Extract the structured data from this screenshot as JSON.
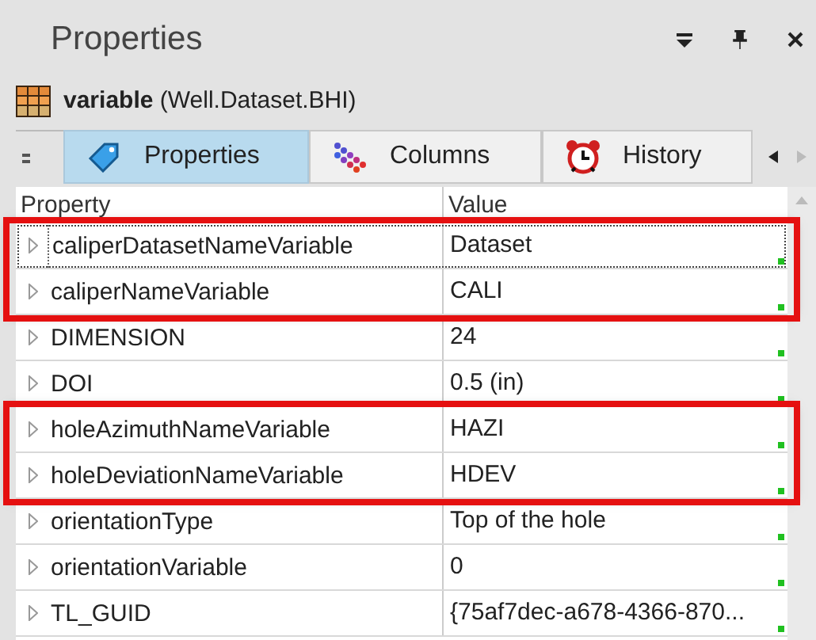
{
  "panel": {
    "title": "Properties"
  },
  "object": {
    "name": "variable",
    "path": "(Well.Dataset.BHI)"
  },
  "tabs": [
    {
      "label": "Properties",
      "selected": true
    },
    {
      "label": "Columns",
      "selected": false
    },
    {
      "label": "History",
      "selected": false
    }
  ],
  "table": {
    "columns": [
      "Property",
      "Value"
    ],
    "rows": [
      {
        "name": "caliperDatasetNameVariable",
        "value": "Dataset",
        "focused": true,
        "highlighted": true
      },
      {
        "name": "caliperNameVariable",
        "value": "CALI",
        "focused": false,
        "highlighted": true
      },
      {
        "name": "DIMENSION",
        "value": "24",
        "focused": false,
        "highlighted": false
      },
      {
        "name": "DOI",
        "value": "0.5 (in)",
        "focused": false,
        "highlighted": false
      },
      {
        "name": "holeAzimuthNameVariable",
        "value": "HAZI",
        "focused": false,
        "highlighted": true
      },
      {
        "name": "holeDeviationNameVariable",
        "value": "HDEV",
        "focused": false,
        "highlighted": true
      },
      {
        "name": "orientationType",
        "value": "Top of the hole",
        "focused": false,
        "highlighted": false
      },
      {
        "name": "orientationVariable",
        "value": "0",
        "focused": false,
        "highlighted": false
      },
      {
        "name": "TL_GUID",
        "value": "{75af7dec-a678-4366-870...",
        "focused": false,
        "highlighted": false
      }
    ]
  }
}
